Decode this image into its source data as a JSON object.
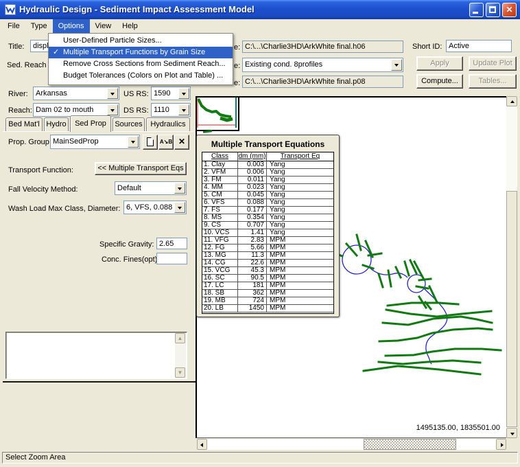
{
  "window": {
    "title": "Hydraulic Design - Sediment Impact Assessment Model"
  },
  "menu": {
    "items": [
      "File",
      "Type",
      "Options",
      "View",
      "Help"
    ],
    "active_item": "Options"
  },
  "options_menu": {
    "check_glyph": "✓",
    "items": [
      {
        "label": "User-Defined Particle Sizes...",
        "checked": false,
        "highlighted": false
      },
      {
        "label": "Multiple Transport Functions by Grain Size",
        "checked": true,
        "highlighted": true
      },
      {
        "label": "Remove Cross Sections from Sediment Reach...",
        "checked": false,
        "highlighted": false
      },
      {
        "label": "Budget Tolerances (Colors on Plot and Table) ...",
        "checked": false,
        "highlighted": false
      }
    ]
  },
  "form": {
    "title_label": "Title:",
    "title_value": "displa",
    "sed_reach_label": "Sed. Reach",
    "path_label_fragment": "e:",
    "hydro_file": "C:\\...\\Charlie3HD\\ArkWhite final.h06",
    "plan_value": "Existing cond. 8profiles",
    "sed_file": "C:\\...\\Charlie3HD\\ArkWhite final.p08",
    "short_id_label": "Short ID:",
    "short_id_value": "Active",
    "apply_button": "Apply",
    "update_plot_button": "Update Plot",
    "compute_button": "Compute...",
    "tables_button": "Tables...",
    "river_label": "River:",
    "river_value": "Arkansas",
    "us_rs_label": "US RS:",
    "us_rs_value": "1590",
    "reach_label": "Reach:",
    "reach_value": "Dam 02 to mouth",
    "ds_rs_label": "DS RS:",
    "ds_rs_value": "1110"
  },
  "tabs": {
    "items": [
      "Bed Mat'l",
      "Hydro",
      "Sed Prop",
      "Sources",
      "Hydraulics"
    ],
    "active": "Sed Prop"
  },
  "sed_prop": {
    "prop_group_label": "Prop. Group",
    "prop_group_value": "MainSedProp",
    "transport_function_label": "Transport Function:",
    "multiple_transport_button": "<< Multiple Transport Eqs",
    "fall_velocity_label": "Fall Velocity Method:",
    "fall_velocity_value": "Default",
    "wash_load_label": "Wash Load Max Class, Diameter:",
    "wash_load_value": "6, VFS, 0.088",
    "specific_gravity_label": "Specific Gravity:",
    "specific_gravity_value": "2.65",
    "conc_fines_label": "Conc. Fines(opt):",
    "conc_fines_value": ""
  },
  "mte": {
    "title": "Multiple Transport Equations",
    "columns": [
      "Class",
      "dm (mm)",
      "Transport Eq"
    ],
    "rows": [
      {
        "class": "1. Clay",
        "dm": "0.003",
        "eq": "Yang"
      },
      {
        "class": "2. VFM",
        "dm": "0.006",
        "eq": "Yang"
      },
      {
        "class": "3. FM",
        "dm": "0.011",
        "eq": "Yang"
      },
      {
        "class": "4. MM",
        "dm": "0.023",
        "eq": "Yang"
      },
      {
        "class": "5. CM",
        "dm": "0.045",
        "eq": "Yang"
      },
      {
        "class": "6. VFS",
        "dm": "0.088",
        "eq": "Yang"
      },
      {
        "class": "7. FS",
        "dm": "0.177",
        "eq": "Yang"
      },
      {
        "class": "8. MS",
        "dm": "0.354",
        "eq": "Yang"
      },
      {
        "class": "9. CS",
        "dm": "0.707",
        "eq": "Yang"
      },
      {
        "class": "10. VCS",
        "dm": "1.41",
        "eq": "Yang"
      },
      {
        "class": "11. VFG",
        "dm": "2.83",
        "eq": "MPM"
      },
      {
        "class": "12. FG",
        "dm": "5.66",
        "eq": "MPM"
      },
      {
        "class": "13. MG",
        "dm": "11.3",
        "eq": "MPM"
      },
      {
        "class": "14. CG",
        "dm": "22.6",
        "eq": "MPM"
      },
      {
        "class": "15. VCG",
        "dm": "45.3",
        "eq": "MPM"
      },
      {
        "class": "16. SC",
        "dm": "90.5",
        "eq": "MPM"
      },
      {
        "class": "17. LC",
        "dm": "181",
        "eq": "MPM"
      },
      {
        "class": "18. SB",
        "dm": "362",
        "eq": "MPM"
      },
      {
        "class": "19. MB",
        "dm": "724",
        "eq": "MPM"
      },
      {
        "class": "20. LB",
        "dm": "1450",
        "eq": "MPM"
      }
    ]
  },
  "plot": {
    "coordinates": "1495135.00, 1835501.00"
  },
  "status_bar": {
    "text": "Select Zoom Area"
  },
  "colors": {
    "selection_blue": "#2E62C9",
    "map_green": "#127A12",
    "river_blue": "#2323C8",
    "teal": "#008080",
    "soft_red": "#E86A6A",
    "dialog_beige": "#ECE9D8"
  }
}
